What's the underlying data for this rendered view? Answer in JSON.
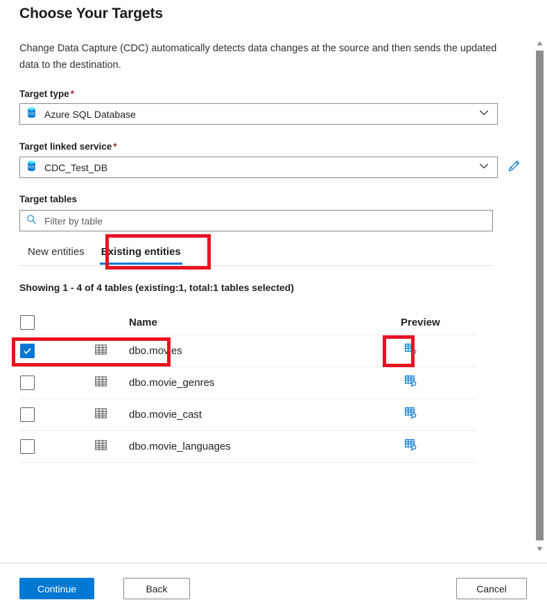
{
  "page": {
    "title": "Choose Your Targets",
    "description": "Change Data Capture (CDC) automatically detects data changes at the source and then sends the updated data to the destination."
  },
  "fields": {
    "target_type": {
      "label": "Target type",
      "required_marker": "*",
      "value": "Azure SQL Database",
      "icon": "azure-sql-database-icon",
      "chevron": "chevron-down-icon"
    },
    "target_linked_service": {
      "label": "Target linked service",
      "required_marker": "*",
      "value": "CDC_Test_DB",
      "icon": "azure-sql-database-icon",
      "chevron": "chevron-down-icon",
      "edit_icon": "pencil-icon"
    },
    "target_tables": {
      "label": "Target tables",
      "search_placeholder": "Filter by table",
      "search_value": "",
      "search_icon": "search-icon"
    }
  },
  "tabs": [
    {
      "label": "New entities",
      "active": false
    },
    {
      "label": "Existing entities",
      "active": true
    }
  ],
  "status": {
    "showing": "Showing 1 - 4 of 4 tables (existing:1, total:1 tables selected)"
  },
  "table": {
    "columns": {
      "select_all": "",
      "name": "Name",
      "preview": "Preview"
    },
    "header_checkbox_checked": false,
    "rows": [
      {
        "checked": true,
        "icon": "table-grid-icon",
        "name": "dbo.movies",
        "preview_icon": "preview-table-icon"
      },
      {
        "checked": false,
        "icon": "table-grid-icon",
        "name": "dbo.movie_genres",
        "preview_icon": "preview-table-icon"
      },
      {
        "checked": false,
        "icon": "table-grid-icon",
        "name": "dbo.movie_cast",
        "preview_icon": "preview-table-icon"
      },
      {
        "checked": false,
        "icon": "table-grid-icon",
        "name": "dbo.movie_languages",
        "preview_icon": "preview-table-icon"
      }
    ]
  },
  "footer": {
    "continue_label": "Continue",
    "back_label": "Back",
    "cancel_label": "Cancel"
  },
  "scrollbar": {
    "up_icon": "scroll-up-arrow-icon",
    "down_icon": "scroll-down-arrow-icon"
  },
  "colors": {
    "accent": "#0078d4",
    "required": "#a4262c",
    "annotation": "#e81123",
    "text": "#201f1e",
    "border": "#8a8886"
  }
}
